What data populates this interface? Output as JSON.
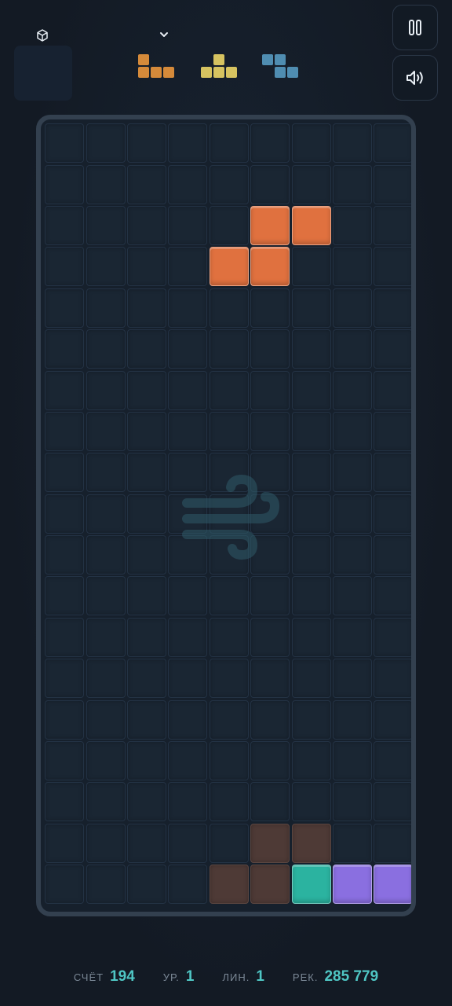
{
  "header": {
    "hold_icon": "cube-icon",
    "dropdown_icon": "chevron-down-icon",
    "pause_icon": "pause-icon",
    "sound_icon": "speaker-icon"
  },
  "next_queue": [
    {
      "shape": "J",
      "color": "#d58a3a"
    },
    {
      "shape": "T",
      "color": "#d6c360"
    },
    {
      "shape": "Z",
      "color": "#4f8db1"
    }
  ],
  "board": {
    "columns": 9,
    "rows": 19,
    "center_icon": "wind-icon",
    "cells": [
      {
        "row": 2,
        "col": 5,
        "color": "#e0713f",
        "type": "active"
      },
      {
        "row": 2,
        "col": 6,
        "color": "#e0713f",
        "type": "active"
      },
      {
        "row": 3,
        "col": 4,
        "color": "#e0713f",
        "type": "active"
      },
      {
        "row": 3,
        "col": 5,
        "color": "#e0713f",
        "type": "active"
      },
      {
        "row": 17,
        "col": 5,
        "color": "#4e3a36",
        "type": "ghost"
      },
      {
        "row": 17,
        "col": 6,
        "color": "#4e3a36",
        "type": "ghost"
      },
      {
        "row": 18,
        "col": 4,
        "color": "#4e3a36",
        "type": "ghost"
      },
      {
        "row": 18,
        "col": 5,
        "color": "#4e3a36",
        "type": "ghost"
      },
      {
        "row": 18,
        "col": 6,
        "color": "#2bb3a0",
        "type": "locked"
      },
      {
        "row": 18,
        "col": 7,
        "color": "#8a6fe0",
        "type": "locked"
      },
      {
        "row": 18,
        "col": 8,
        "color": "#8a6fe0",
        "type": "locked"
      }
    ]
  },
  "stats": {
    "score_label": "СЧЁТ",
    "score_value": "194",
    "level_label": "УР.",
    "level_value": "1",
    "lines_label": "ЛИН.",
    "lines_value": "1",
    "record_label": "РЕК.",
    "record_value": "285 779"
  }
}
